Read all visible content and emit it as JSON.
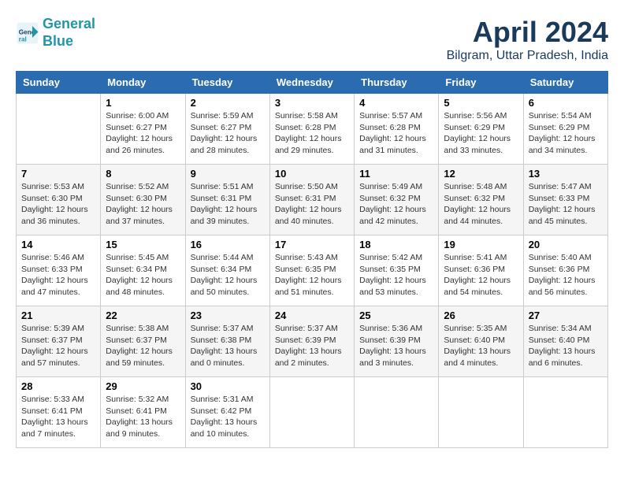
{
  "header": {
    "logo_line1": "General",
    "logo_line2": "Blue",
    "month_title": "April 2024",
    "subtitle": "Bilgram, Uttar Pradesh, India"
  },
  "weekdays": [
    "Sunday",
    "Monday",
    "Tuesday",
    "Wednesday",
    "Thursday",
    "Friday",
    "Saturday"
  ],
  "weeks": [
    [
      {
        "day": "",
        "info": ""
      },
      {
        "day": "1",
        "info": "Sunrise: 6:00 AM\nSunset: 6:27 PM\nDaylight: 12 hours\nand 26 minutes."
      },
      {
        "day": "2",
        "info": "Sunrise: 5:59 AM\nSunset: 6:27 PM\nDaylight: 12 hours\nand 28 minutes."
      },
      {
        "day": "3",
        "info": "Sunrise: 5:58 AM\nSunset: 6:28 PM\nDaylight: 12 hours\nand 29 minutes."
      },
      {
        "day": "4",
        "info": "Sunrise: 5:57 AM\nSunset: 6:28 PM\nDaylight: 12 hours\nand 31 minutes."
      },
      {
        "day": "5",
        "info": "Sunrise: 5:56 AM\nSunset: 6:29 PM\nDaylight: 12 hours\nand 33 minutes."
      },
      {
        "day": "6",
        "info": "Sunrise: 5:54 AM\nSunset: 6:29 PM\nDaylight: 12 hours\nand 34 minutes."
      }
    ],
    [
      {
        "day": "7",
        "info": "Sunrise: 5:53 AM\nSunset: 6:30 PM\nDaylight: 12 hours\nand 36 minutes."
      },
      {
        "day": "8",
        "info": "Sunrise: 5:52 AM\nSunset: 6:30 PM\nDaylight: 12 hours\nand 37 minutes."
      },
      {
        "day": "9",
        "info": "Sunrise: 5:51 AM\nSunset: 6:31 PM\nDaylight: 12 hours\nand 39 minutes."
      },
      {
        "day": "10",
        "info": "Sunrise: 5:50 AM\nSunset: 6:31 PM\nDaylight: 12 hours\nand 40 minutes."
      },
      {
        "day": "11",
        "info": "Sunrise: 5:49 AM\nSunset: 6:32 PM\nDaylight: 12 hours\nand 42 minutes."
      },
      {
        "day": "12",
        "info": "Sunrise: 5:48 AM\nSunset: 6:32 PM\nDaylight: 12 hours\nand 44 minutes."
      },
      {
        "day": "13",
        "info": "Sunrise: 5:47 AM\nSunset: 6:33 PM\nDaylight: 12 hours\nand 45 minutes."
      }
    ],
    [
      {
        "day": "14",
        "info": "Sunrise: 5:46 AM\nSunset: 6:33 PM\nDaylight: 12 hours\nand 47 minutes."
      },
      {
        "day": "15",
        "info": "Sunrise: 5:45 AM\nSunset: 6:34 PM\nDaylight: 12 hours\nand 48 minutes."
      },
      {
        "day": "16",
        "info": "Sunrise: 5:44 AM\nSunset: 6:34 PM\nDaylight: 12 hours\nand 50 minutes."
      },
      {
        "day": "17",
        "info": "Sunrise: 5:43 AM\nSunset: 6:35 PM\nDaylight: 12 hours\nand 51 minutes."
      },
      {
        "day": "18",
        "info": "Sunrise: 5:42 AM\nSunset: 6:35 PM\nDaylight: 12 hours\nand 53 minutes."
      },
      {
        "day": "19",
        "info": "Sunrise: 5:41 AM\nSunset: 6:36 PM\nDaylight: 12 hours\nand 54 minutes."
      },
      {
        "day": "20",
        "info": "Sunrise: 5:40 AM\nSunset: 6:36 PM\nDaylight: 12 hours\nand 56 minutes."
      }
    ],
    [
      {
        "day": "21",
        "info": "Sunrise: 5:39 AM\nSunset: 6:37 PM\nDaylight: 12 hours\nand 57 minutes."
      },
      {
        "day": "22",
        "info": "Sunrise: 5:38 AM\nSunset: 6:37 PM\nDaylight: 12 hours\nand 59 minutes."
      },
      {
        "day": "23",
        "info": "Sunrise: 5:37 AM\nSunset: 6:38 PM\nDaylight: 13 hours\nand 0 minutes."
      },
      {
        "day": "24",
        "info": "Sunrise: 5:37 AM\nSunset: 6:39 PM\nDaylight: 13 hours\nand 2 minutes."
      },
      {
        "day": "25",
        "info": "Sunrise: 5:36 AM\nSunset: 6:39 PM\nDaylight: 13 hours\nand 3 minutes."
      },
      {
        "day": "26",
        "info": "Sunrise: 5:35 AM\nSunset: 6:40 PM\nDaylight: 13 hours\nand 4 minutes."
      },
      {
        "day": "27",
        "info": "Sunrise: 5:34 AM\nSunset: 6:40 PM\nDaylight: 13 hours\nand 6 minutes."
      }
    ],
    [
      {
        "day": "28",
        "info": "Sunrise: 5:33 AM\nSunset: 6:41 PM\nDaylight: 13 hours\nand 7 minutes."
      },
      {
        "day": "29",
        "info": "Sunrise: 5:32 AM\nSunset: 6:41 PM\nDaylight: 13 hours\nand 9 minutes."
      },
      {
        "day": "30",
        "info": "Sunrise: 5:31 AM\nSunset: 6:42 PM\nDaylight: 13 hours\nand 10 minutes."
      },
      {
        "day": "",
        "info": ""
      },
      {
        "day": "",
        "info": ""
      },
      {
        "day": "",
        "info": ""
      },
      {
        "day": "",
        "info": ""
      }
    ]
  ]
}
